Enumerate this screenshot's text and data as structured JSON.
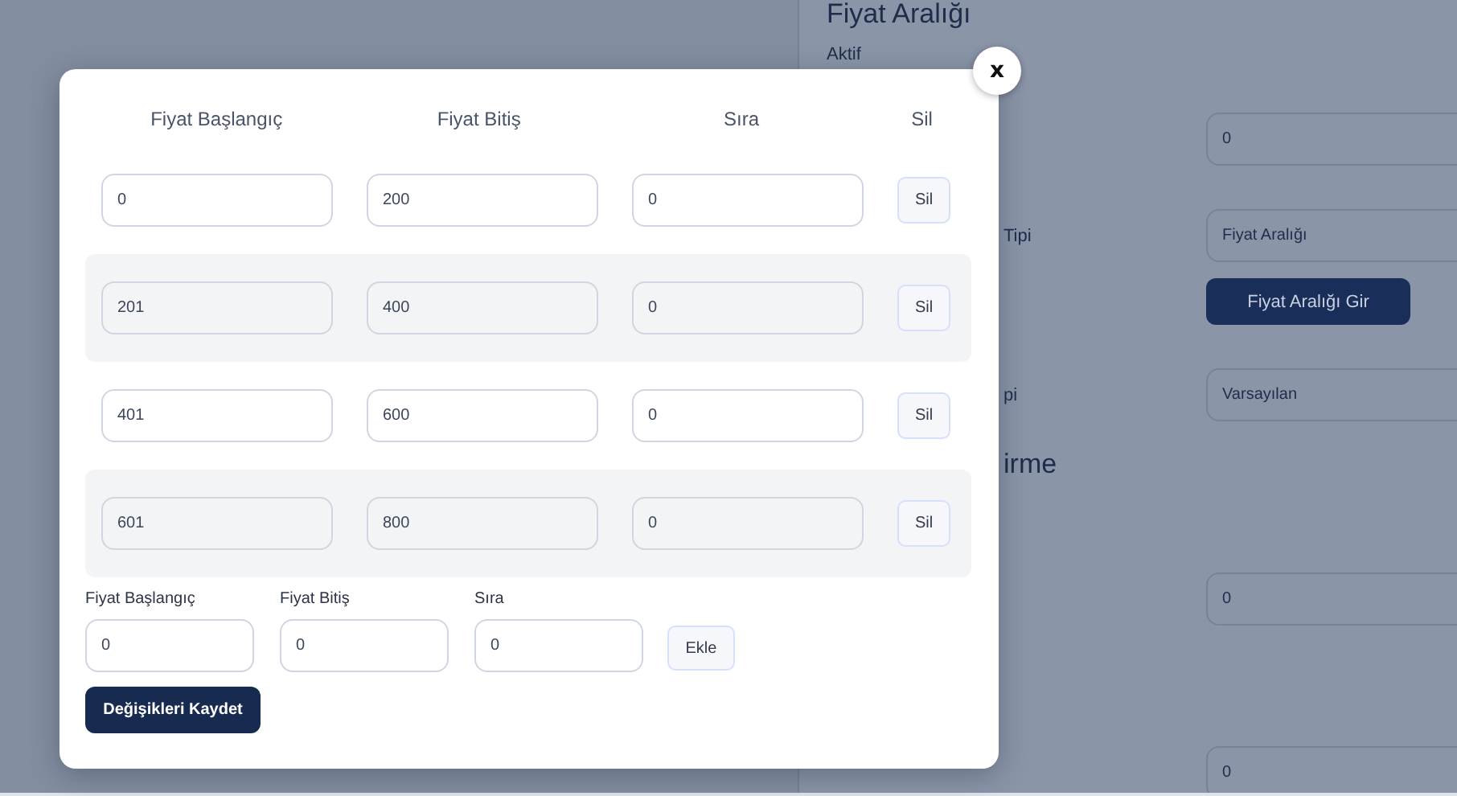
{
  "background_panel": {
    "items": [
      {
        "kind": "heading",
        "text": "Fiyat Aralığı"
      },
      {
        "kind": "label",
        "text": "Aktif"
      },
      {
        "kind": "field",
        "value": "0"
      },
      {
        "kind": "field",
        "label": "Tipi",
        "value": "Fiyat Aralığı"
      },
      {
        "kind": "button",
        "text": "Fiyat Aralığı Gir"
      },
      {
        "kind": "field",
        "label": "pi",
        "value": "Varsayılan"
      },
      {
        "kind": "heading_partial",
        "text": "irme"
      },
      {
        "kind": "field",
        "value": "0"
      },
      {
        "kind": "field",
        "value": "0"
      }
    ]
  },
  "modal": {
    "close": "x",
    "columns": [
      "Fiyat Başlangıç",
      "Fiyat Bitiş",
      "Sıra",
      "Sil"
    ],
    "rows": [
      {
        "start": "0",
        "end": "200",
        "order": "0",
        "delete": "Sil"
      },
      {
        "start": "201",
        "end": "400",
        "order": "0",
        "delete": "Sil"
      },
      {
        "start": "401",
        "end": "600",
        "order": "0",
        "delete": "Sil"
      },
      {
        "start": "601",
        "end": "800",
        "order": "0",
        "delete": "Sil"
      }
    ],
    "new_row": {
      "start_label": "Fiyat Başlangıç",
      "start": "0",
      "end_label": "Fiyat Bitiş",
      "end": "0",
      "order_label": "Sıra",
      "order": "0",
      "add": "Ekle"
    },
    "save": "Değişikleri Kaydet"
  }
}
